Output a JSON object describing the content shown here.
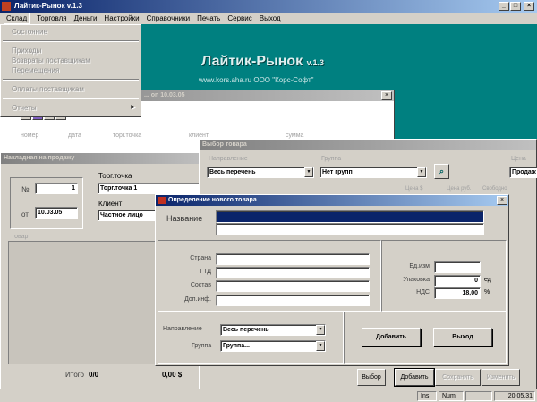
{
  "app": {
    "title": "Лайтик-Рынок v.1.3"
  },
  "menubar": [
    "Склад",
    "Торговля",
    "Деньги",
    "Настройки",
    "Справочники",
    "Печать",
    "Сервис",
    "Выход"
  ],
  "sklad_menu": {
    "items": [
      "Состояние",
      "Приходы",
      "Возвраты поставщикам",
      "Перемещения",
      "Оплаты поставщикам",
      "Отчеты"
    ]
  },
  "desktop": {
    "logo": "Лайтик-Рынок",
    "version": "v.1.3",
    "subtitle": "www.kors.aha.ru ООО \"Корс-Софт\""
  },
  "list_window": {
    "title": "... on 10.03.05",
    "columns": [
      "номер",
      "дата",
      "торг.точка",
      "клиент",
      "сумма"
    ]
  },
  "invoice": {
    "title": "Накладная на продажу",
    "no_label": "№",
    "no_value": "1",
    "date_label": "от",
    "date_value": "10.03.05",
    "point_label": "Торг.точка",
    "point_value": "Торг.точка 1",
    "client_label": "Клиент",
    "client_value": "Частное лицо",
    "items_label": "товар",
    "total_label": "Итого",
    "total_count": "0/0",
    "total_sum": "0,00 $"
  },
  "choose": {
    "title": "Выбор товара",
    "direction_label": "Направление",
    "direction_value": "Весь перечень",
    "group_label": "Группа",
    "group_value": "Нет групп",
    "price_label": "Цена",
    "price_value": "Продаж",
    "columns": [
      "Цена $",
      "Цена руб.",
      "Свободно"
    ],
    "buttons": {
      "select": "Выбор",
      "add": "Добавить",
      "save": "Сохранить",
      "edit": "Изменить"
    }
  },
  "dialog": {
    "title": "Определение нового товара",
    "name_label": "Название",
    "country": "Страна",
    "gtd": "ГТД",
    "composition": "Состав",
    "extra": "Доп.инф.",
    "unit_label": "Ед.изм",
    "pack_label": "Упаковка",
    "pack_value": "0",
    "pack_unit": "ед",
    "vat_label": "НДС",
    "vat_value": "18,00",
    "vat_unit": "%",
    "direction_label": "Направление",
    "direction_value": "Весь перечень",
    "group_label": "Группа",
    "group_value": "Группа...",
    "add": "Добавить",
    "exit": "Выход"
  },
  "statusbar": {
    "ins": "Ins",
    "num": "Num",
    "time": "20.05.31"
  }
}
